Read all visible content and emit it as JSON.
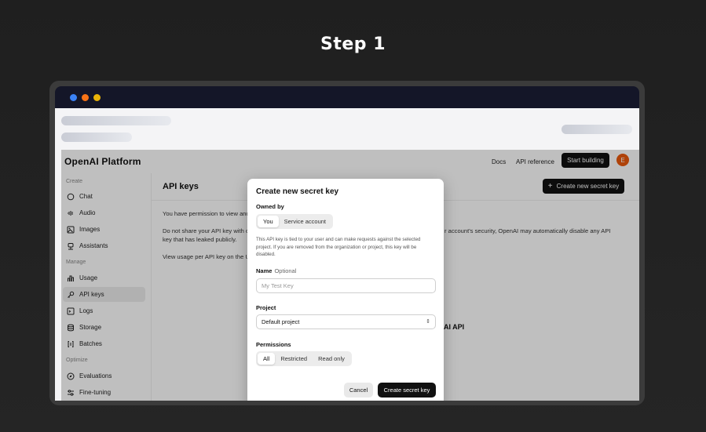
{
  "step": {
    "title": "Step 1"
  },
  "app": {
    "logo": "OpenAI Platform",
    "nav": {
      "docs": "Docs",
      "api_reference": "API reference",
      "start_building": "Start building",
      "avatar_initial": "E"
    }
  },
  "sidebar": {
    "sections": {
      "create": "Create",
      "manage": "Manage",
      "optimize": "Optimize"
    },
    "items": [
      {
        "label": "Chat",
        "icon": "chat-bubble-icon"
      },
      {
        "label": "Audio",
        "icon": "audio-wave-icon"
      },
      {
        "label": "Images",
        "icon": "image-icon"
      },
      {
        "label": "Assistants",
        "icon": "assistant-icon"
      },
      {
        "label": "Usage",
        "icon": "bar-chart-icon"
      },
      {
        "label": "API keys",
        "icon": "key-icon"
      },
      {
        "label": "Logs",
        "icon": "terminal-icon"
      },
      {
        "label": "Storage",
        "icon": "database-icon"
      },
      {
        "label": "Batches",
        "icon": "batch-icon"
      },
      {
        "label": "Evaluations",
        "icon": "compass-icon"
      },
      {
        "label": "Fine-tuning",
        "icon": "sliders-icon"
      }
    ]
  },
  "main": {
    "title": "API keys",
    "create_button": "Create new secret key",
    "line1": "You have permission to view and",
    "line2_left": "Do not share your API key with o",
    "line2_right": "r account's security, OpenAI may automatically disable any API",
    "line3": "key that has leaked publicly.",
    "line4": "View usage per API key on the U",
    "heading_fragment": "AI API"
  },
  "modal": {
    "title": "Create new secret key",
    "owned_by_label": "Owned by",
    "owned_options": [
      "You",
      "Service account"
    ],
    "owned_selected": "You",
    "help_text": "This API key is tied to your user and can make requests against the selected project. If you are removed from the organization or project, this key will be disabled.",
    "name_label": "Name",
    "name_optional": "Optional",
    "name_placeholder": "My Test Key",
    "project_label": "Project",
    "project_value": "Default project",
    "permissions_label": "Permissions",
    "permission_options": [
      "All",
      "Restricted",
      "Read only"
    ],
    "permission_selected": "All",
    "cancel": "Cancel",
    "create": "Create secret key"
  },
  "colors": {
    "accent": "#111111",
    "avatar": "#ea580c",
    "dot_blue": "#3b82f6",
    "dot_orange": "#f97316",
    "dot_yellow": "#eab308"
  }
}
